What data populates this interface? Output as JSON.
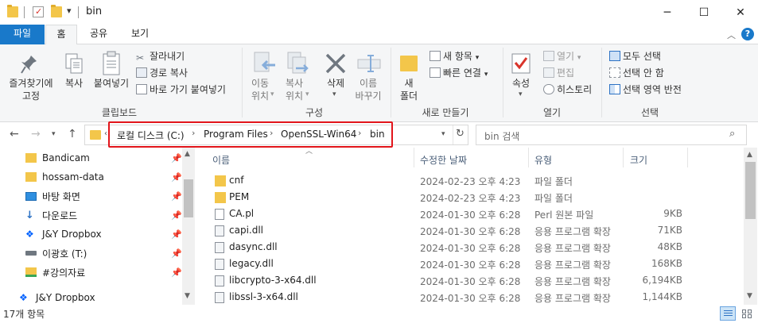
{
  "window": {
    "title": "bin",
    "controls": {
      "minimize": "─",
      "maximize": "☐",
      "close": "✕"
    }
  },
  "ribbon_tabs": {
    "file": "파일",
    "home": "홈",
    "share": "공유",
    "view": "보기"
  },
  "ribbon": {
    "clipboard": {
      "label": "클립보드",
      "pin": "즐겨찾기에\n고정",
      "copy": "복사",
      "paste": "붙여넣기",
      "cut": "잘라내기",
      "copy_path": "경로 복사",
      "paste_shortcut": "바로 가기 붙여넣기"
    },
    "organize": {
      "label": "구성",
      "move_to": "이동\n위치",
      "copy_to": "복사\n위치",
      "delete": "삭제",
      "rename": "이름\n바꾸기"
    },
    "new": {
      "label": "새로 만들기",
      "new_folder": "새\n폴더",
      "new_item": "새 항목",
      "easy_access": "빠른 연결"
    },
    "open": {
      "label": "열기",
      "properties": "속성",
      "open": "열기",
      "edit": "편집",
      "history": "히스토리"
    },
    "select": {
      "label": "선택",
      "select_all": "모두 선택",
      "select_none": "선택 안 함",
      "invert": "선택 영역 반전"
    }
  },
  "address": {
    "crumbs": [
      "로컬 디스크 (C:)",
      "Program Files",
      "OpenSSL-Win64",
      "bin"
    ],
    "search_placeholder": "bin 검색"
  },
  "nav_pane": {
    "items": [
      {
        "label": "Bandicam",
        "icon": "folder-icon",
        "pinned": true
      },
      {
        "label": "hossam-data",
        "icon": "folder-icon",
        "pinned": true
      },
      {
        "label": "바탕 화면",
        "icon": "desktop-icon",
        "pinned": true
      },
      {
        "label": "다운로드",
        "icon": "download-icon",
        "pinned": true
      },
      {
        "label": "J&Y Dropbox",
        "icon": "dropbox-icon",
        "pinned": true
      },
      {
        "label": "이광호 (T:)",
        "icon": "drive-icon",
        "pinned": true
      },
      {
        "label": "#강의자료",
        "icon": "folder-icon",
        "pinned": true
      },
      {
        "label": "J&Y Dropbox",
        "icon": "dropbox-icon",
        "pinned": false
      }
    ]
  },
  "file_list": {
    "columns": {
      "name": "이름",
      "modified": "수정한 날짜",
      "type": "유형",
      "size": "크기"
    },
    "rows": [
      {
        "name": "cnf",
        "modified": "2024-02-23 오후 4:23",
        "type": "파일 폴더",
        "size": "",
        "icon": "folder-icon"
      },
      {
        "name": "PEM",
        "modified": "2024-02-23 오후 4:23",
        "type": "파일 폴더",
        "size": "",
        "icon": "folder-icon"
      },
      {
        "name": "CA.pl",
        "modified": "2024-01-30 오후 6:28",
        "type": "Perl 원본 파일",
        "size": "9KB",
        "icon": "file-icon"
      },
      {
        "name": "capi.dll",
        "modified": "2024-01-30 오후 6:28",
        "type": "응용 프로그램 확장",
        "size": "71KB",
        "icon": "dll-icon"
      },
      {
        "name": "dasync.dll",
        "modified": "2024-01-30 오후 6:28",
        "type": "응용 프로그램 확장",
        "size": "48KB",
        "icon": "dll-icon"
      },
      {
        "name": "legacy.dll",
        "modified": "2024-01-30 오후 6:28",
        "type": "응용 프로그램 확장",
        "size": "168KB",
        "icon": "dll-icon"
      },
      {
        "name": "libcrypto-3-x64.dll",
        "modified": "2024-01-30 오후 6:28",
        "type": "응용 프로그램 확장",
        "size": "6,194KB",
        "icon": "dll-icon"
      },
      {
        "name": "libssl-3-x64.dll",
        "modified": "2024-01-30 오후 6:28",
        "type": "응용 프로그램 확장",
        "size": "1,144KB",
        "icon": "dll-icon"
      }
    ]
  },
  "status": {
    "item_count": "17개 항목"
  },
  "colors": {
    "accent": "#1979ca",
    "folder": "#f3c64a",
    "highlight": "#e2151b"
  }
}
